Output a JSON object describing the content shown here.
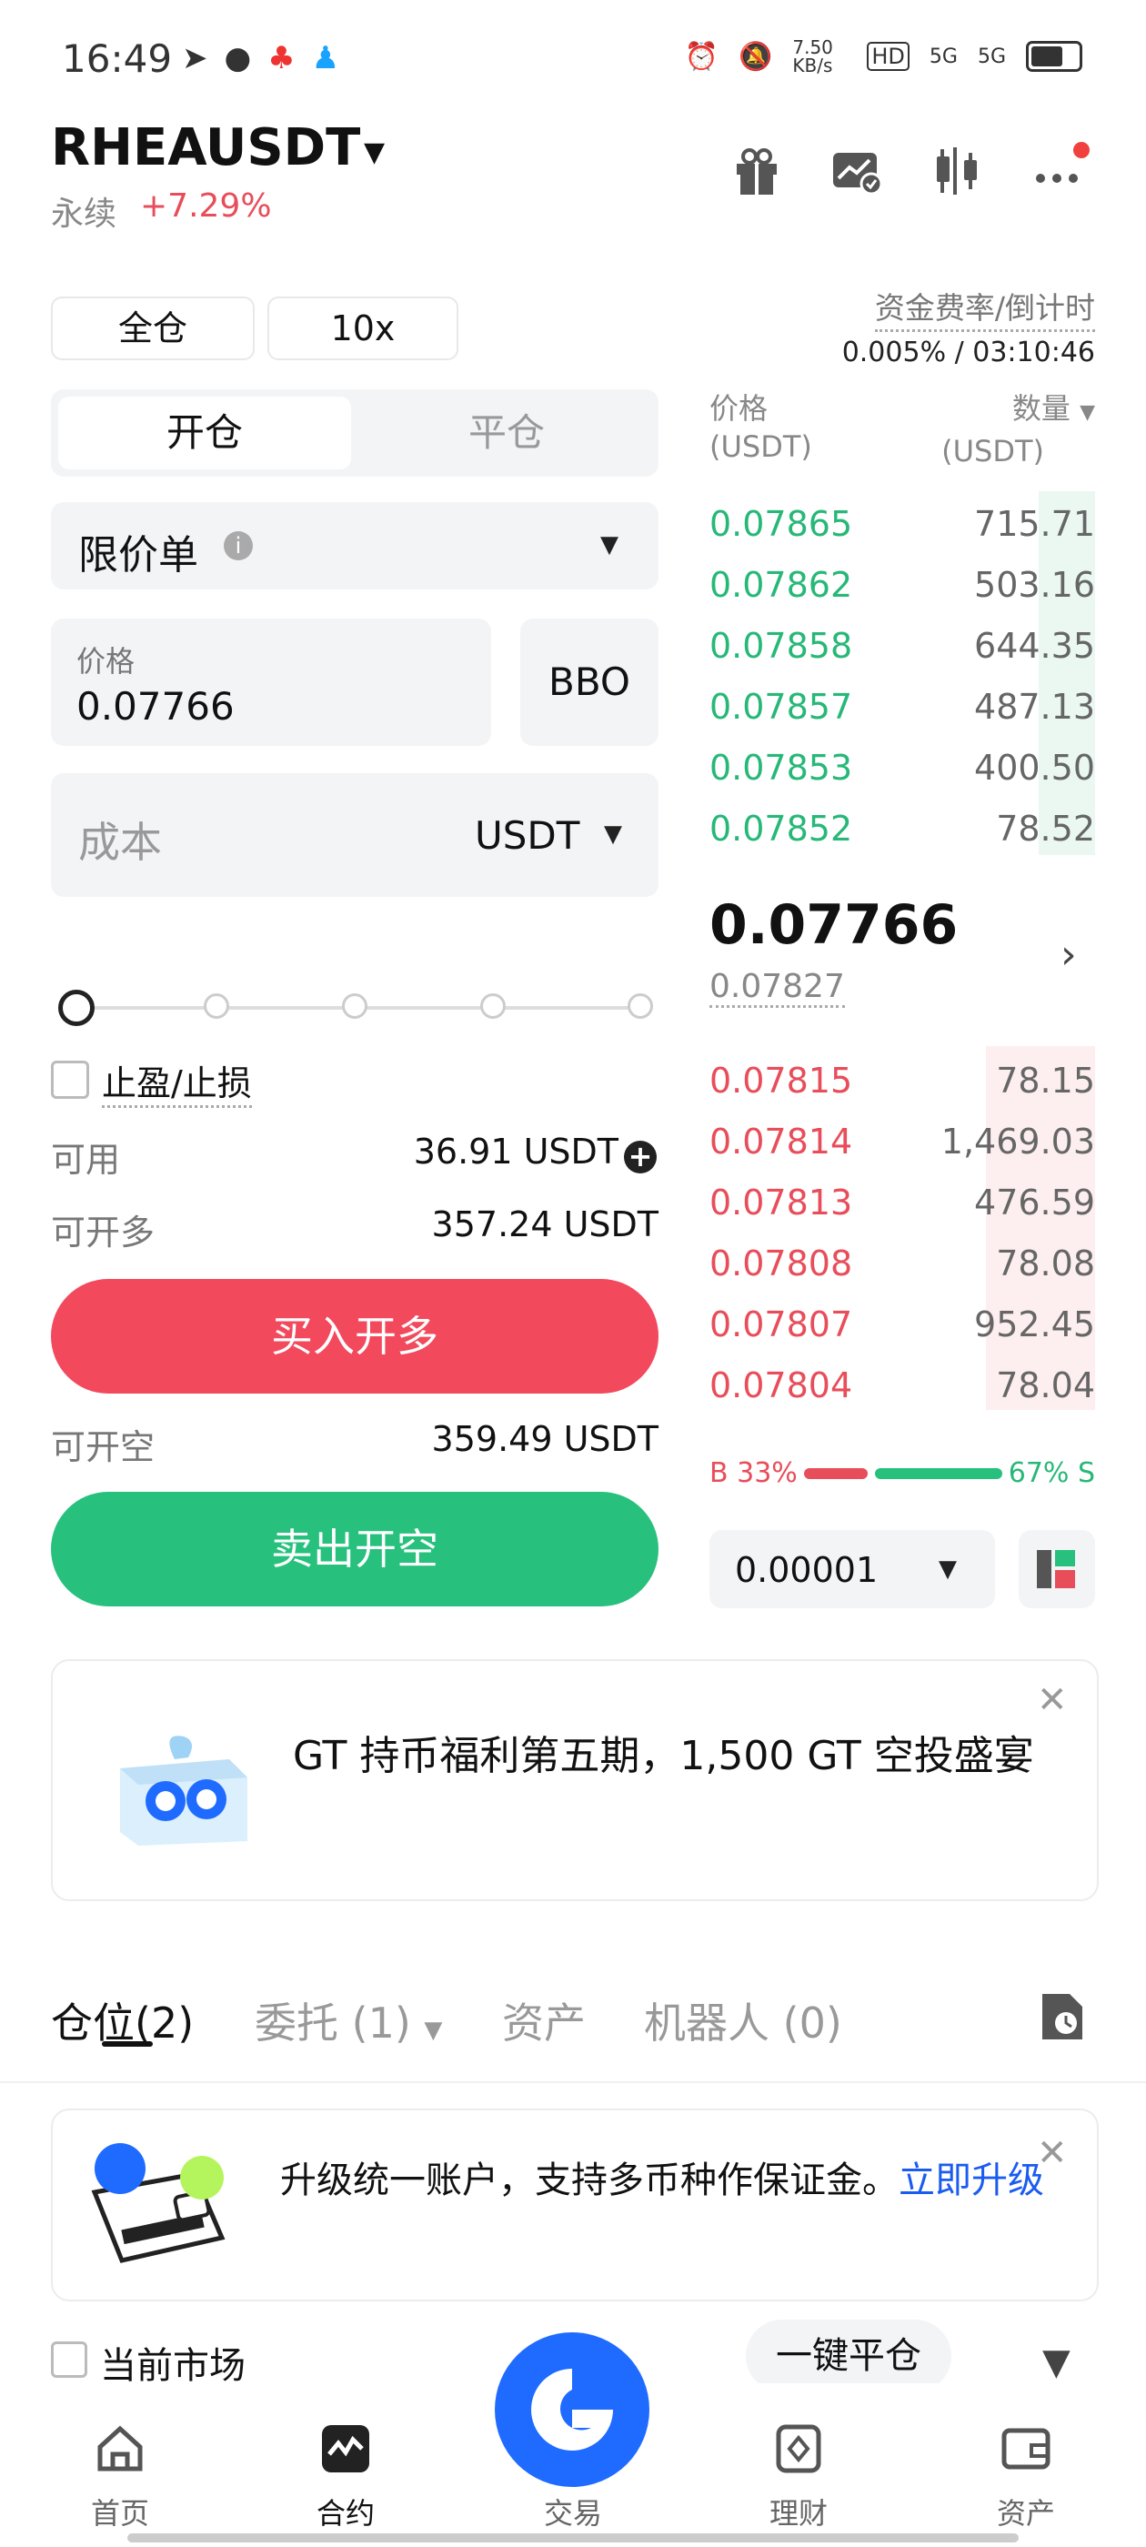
{
  "status_bar": {
    "time": "16:49",
    "speed": "7.50 KB/s",
    "net1": "HD",
    "net2": "5G",
    "net3": "5G"
  },
  "header": {
    "pair": "RHEAUSDT",
    "type": "永续",
    "change": "+7.29%",
    "icons": [
      "gift-icon",
      "chart-check-icon",
      "candlestick-icon",
      "more-icon"
    ]
  },
  "margin": {
    "mode": "全仓",
    "leverage": "10x",
    "funding_label": "资金费率/倒计时",
    "funding_value": "0.005% / 03:10:46"
  },
  "order_form": {
    "tab_open": "开仓",
    "tab_close": "平仓",
    "order_type": "限价单",
    "price_label": "价格",
    "price_value": "0.07766",
    "bbo": "BBO",
    "cost_placeholder": "成本",
    "cost_unit": "USDT",
    "slider_percent": 0,
    "tpsl_label": "止盈/止损",
    "available_label": "可用",
    "available_value": "36.91  USDT",
    "can_long_label": "可开多",
    "can_long_value": "357.24 USDT",
    "buy_button": "买入开多",
    "can_short_label": "可开空",
    "can_short_value": "359.49 USDT",
    "sell_button": "卖出开空"
  },
  "order_book": {
    "price_header": "价格",
    "price_unit": "(USDT)",
    "qty_header": "数量",
    "qty_unit": "(USDT)",
    "asks": [
      {
        "price": "0.07865",
        "qty": "715.71"
      },
      {
        "price": "0.07862",
        "qty": "503.16"
      },
      {
        "price": "0.07858",
        "qty": "644.35"
      },
      {
        "price": "0.07857",
        "qty": "487.13"
      },
      {
        "price": "0.07853",
        "qty": "400.50"
      },
      {
        "price": "0.07852",
        "qty": "78.52"
      }
    ],
    "last_price": "0.07766",
    "mark_price": "0.07827",
    "bids": [
      {
        "price": "0.07815",
        "qty": "78.15"
      },
      {
        "price": "0.07814",
        "qty": "1,469.03"
      },
      {
        "price": "0.07813",
        "qty": "476.59"
      },
      {
        "price": "0.07808",
        "qty": "78.08"
      },
      {
        "price": "0.07807",
        "qty": "952.45"
      },
      {
        "price": "0.07804",
        "qty": "78.04"
      }
    ],
    "buy_ratio": "B 33%",
    "sell_ratio": "67% S",
    "precision": "0.00001"
  },
  "promo": {
    "text": "GT 持币福利第五期，1,500 GT 空投盛宴"
  },
  "positions": {
    "tab_positions": "仓位",
    "tab_positions_count": "(2)",
    "tab_orders": "委托 (1)",
    "tab_assets": "资产",
    "tab_bots": "机器人 (0)"
  },
  "upgrade": {
    "text": "升级统一账户，支持多币种作保证金。",
    "link": "立即升级"
  },
  "filters": {
    "current_market": "当前市场",
    "close_all": "一键平仓"
  },
  "nav": {
    "home": "首页",
    "futures": "合约",
    "trade": "交易",
    "earn": "理财",
    "assets": "资产"
  },
  "colors": {
    "buy": "#f2495d",
    "sell": "#27c17d",
    "link": "#1b5cf0",
    "brand": "#1f6bff"
  }
}
